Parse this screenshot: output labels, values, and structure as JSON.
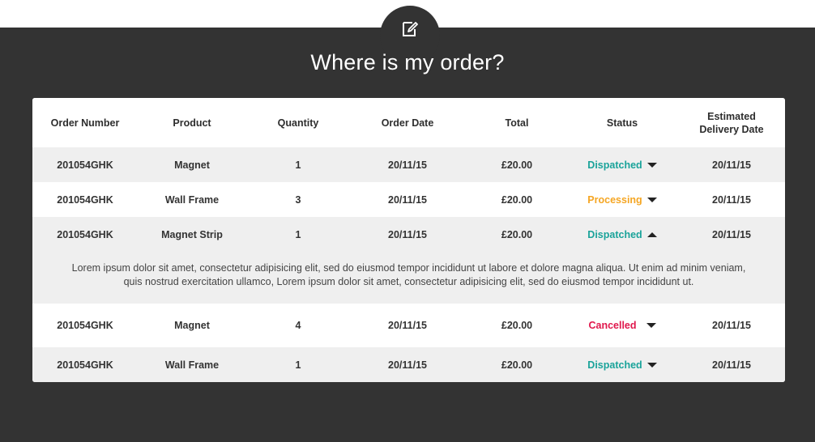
{
  "header": {
    "title": "Where is my order?",
    "icon": "edit-note-icon"
  },
  "table": {
    "columns": [
      "Order Number",
      "Product",
      "Quantity",
      "Order Date",
      "Total",
      "Status",
      "Estimated Delivery Date"
    ],
    "rows": [
      {
        "order_number": "201054GHK",
        "product": "Magnet",
        "quantity": "1",
        "order_date": "20/11/15",
        "total": "£20.00",
        "status": "Dispatched",
        "status_color": "#1aa39a",
        "expanded": false,
        "delivery_date": "20/11/15"
      },
      {
        "order_number": "201054GHK",
        "product": "Wall Frame",
        "quantity": "3",
        "order_date": "20/11/15",
        "total": "£20.00",
        "status": "Processing",
        "status_color": "#f5a623",
        "expanded": false,
        "delivery_date": "20/11/15"
      },
      {
        "order_number": "201054GHK",
        "product": "Magnet Strip",
        "quantity": "1",
        "order_date": "20/11/15",
        "total": "£20.00",
        "status": "Dispatched",
        "status_color": "#1aa39a",
        "expanded": true,
        "delivery_date": "20/11/15",
        "details_line1": "Lorem ipsum dolor sit amet, consectetur adipisicing elit, sed do eiusmod tempor incididunt ut labore et dolore magna aliqua. Ut enim ad minim veniam,",
        "details_line2": "quis nostrud exercitation ullamco, Lorem ipsum dolor sit amet, consectetur adipisicing elit, sed do eiusmod tempor incididunt ut."
      },
      {
        "order_number": "201054GHK",
        "product": "Magnet",
        "quantity": "4",
        "order_date": "20/11/15",
        "total": "£20.00",
        "status": "Cancelled",
        "status_color": "#e0174c",
        "expanded": false,
        "delivery_date": "20/11/15"
      },
      {
        "order_number": "201054GHK",
        "product": "Wall Frame",
        "quantity": "1",
        "order_date": "20/11/15",
        "total": "£20.00",
        "status": "Dispatched",
        "status_color": "#1aa39a",
        "expanded": false,
        "delivery_date": "20/11/15"
      }
    ]
  },
  "colors": {
    "background": "#333333",
    "card": "#ffffff",
    "row_alt": "#efefef",
    "dispatched": "#1aa39a",
    "processing": "#f5a623",
    "cancelled": "#e0174c"
  }
}
